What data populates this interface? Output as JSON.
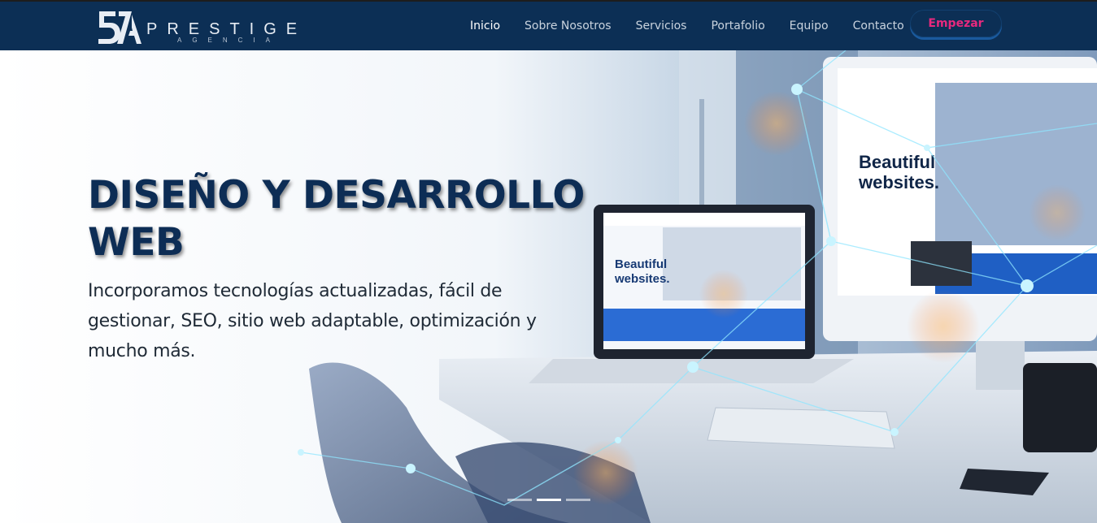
{
  "brand": {
    "mark": "57A",
    "name": "PRESTIGE",
    "tagline": "AGENCIA"
  },
  "nav": {
    "items": [
      {
        "label": "Inicio",
        "active": true
      },
      {
        "label": "Sobre Nosotros"
      },
      {
        "label": "Servicios"
      },
      {
        "label": "Portafolio"
      },
      {
        "label": "Equipo"
      },
      {
        "label": "Contacto"
      }
    ],
    "cta_label": "Empezar"
  },
  "hero": {
    "title": "DISEÑO Y DESARROLLO WEB",
    "subtitle": "Incorporamos tecnologías actualizadas, fácil de gestionar, SEO, sitio web adaptable, optimización y mucho más.",
    "laptop_screen_heading": "Beautiful websites.",
    "monitor_screen_heading": "Beautiful websites."
  },
  "carousel": {
    "slide_count": 3,
    "active_index": 1
  },
  "colors": {
    "nav_bg": "#0c2f55",
    "cta_text": "#e8297e",
    "title": "#0d2d55"
  }
}
